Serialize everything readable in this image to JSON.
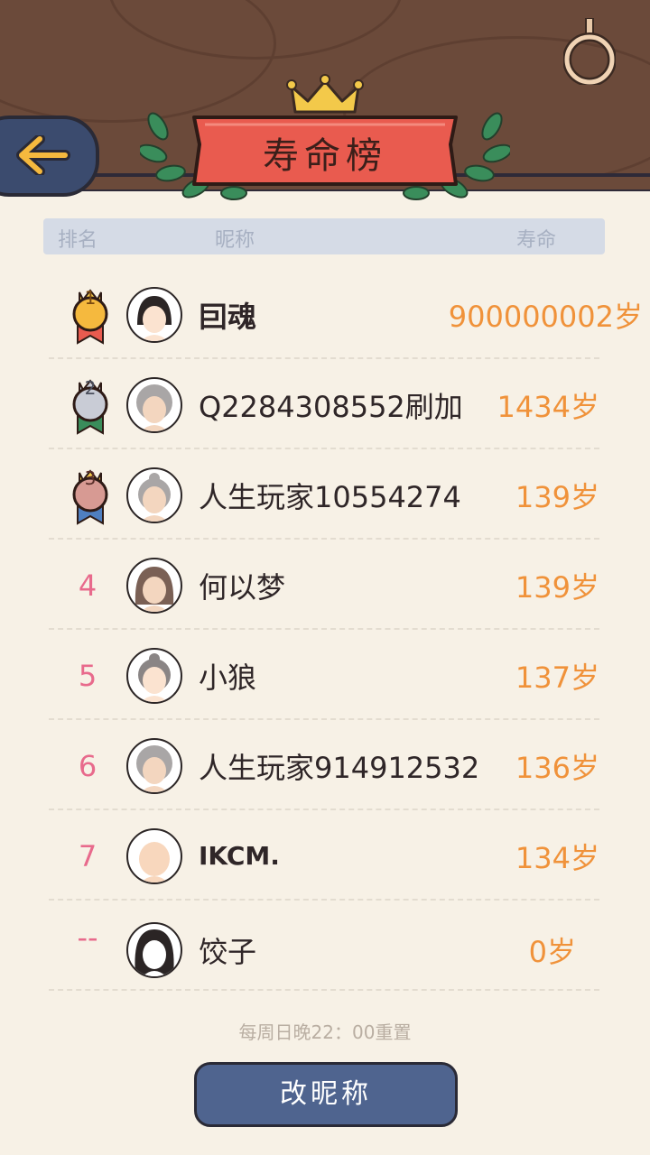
{
  "header": {
    "title": "寿命榜",
    "back_icon": "arrow-left-icon",
    "colors": {
      "wood": "#6b4a3a",
      "banner": "#e95b4f",
      "leaf": "#3a8d5b",
      "crown": "#f3c94a"
    }
  },
  "columns": {
    "rank": "排名",
    "nickname": "昵称",
    "lifespan": "寿命"
  },
  "rows": [
    {
      "rank": "1",
      "nickname": "囙魂",
      "lifespan": "900000002岁"
    },
    {
      "rank": "2",
      "nickname": "Q2284308552刷加",
      "lifespan": "1434岁"
    },
    {
      "rank": "3",
      "nickname": "人生玩家10554274",
      "lifespan": "139岁"
    },
    {
      "rank": "4",
      "nickname": "何以梦",
      "lifespan": "139岁"
    },
    {
      "rank": "5",
      "nickname": "小狼",
      "lifespan": "137岁"
    },
    {
      "rank": "6",
      "nickname": "人生玩家914912532",
      "lifespan": "136岁"
    },
    {
      "rank": "7",
      "nickname": "IKCM.",
      "lifespan": "134岁"
    },
    {
      "rank": "--",
      "nickname": "饺子",
      "lifespan": "0岁"
    }
  ],
  "reset_note": "每周日晚22：00重置",
  "rename_button": "改昵称",
  "colors": {
    "life": "#f0923a",
    "rank": "#e86a8c",
    "button": "#4f648f"
  }
}
